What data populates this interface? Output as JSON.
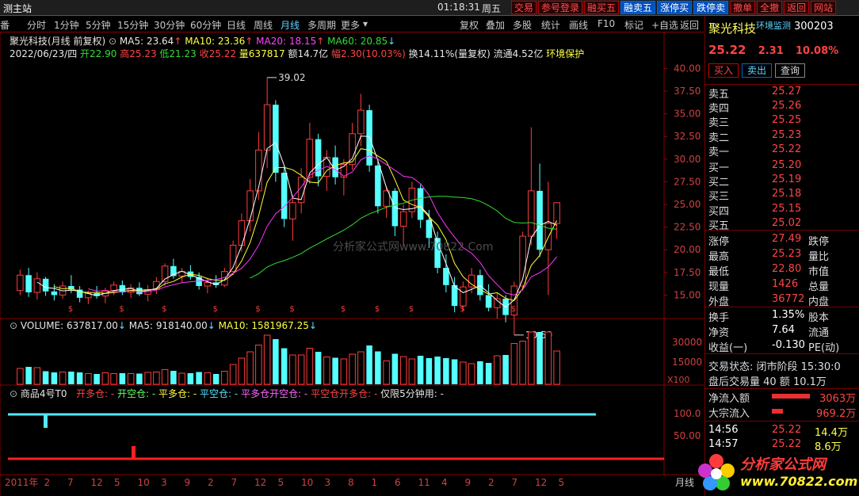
{
  "window": {
    "title": "测主站",
    "clock": "01:18:31",
    "weekday": "周五"
  },
  "top_buttons": [
    "交易",
    "参号登录",
    "融买五",
    "融卖五",
    "涨停买",
    "跌停卖",
    "撤单",
    "全撤",
    "返回",
    "网站"
  ],
  "nav": {
    "items": [
      "分时",
      "1分钟",
      "5分钟",
      "15分钟",
      "30分钟",
      "60分钟",
      "日线",
      "周线",
      "月线",
      "多周期",
      "更多"
    ],
    "right_items": [
      "复权",
      "叠加",
      "多股",
      "统计",
      "画线",
      "F10",
      "标记",
      "+自选",
      "返回"
    ],
    "active": "月线"
  },
  "stock": {
    "title": "聚光科技(月线 前复权)",
    "ma5": "MA5: 23.64",
    "ma10": "MA10: 23.36",
    "ma20": "MA20: 18.15",
    "ma60": "MA60: 20.85",
    "date": "2022/06/23/四",
    "open": "开22.90",
    "high": "高25.23",
    "low": "低21.23",
    "close": "收25.22",
    "vol": "量637817",
    "amt": "额14.7亿",
    "range": "幅2.30(10.03%)",
    "turnover": "换14.11%(量复权)",
    "float": "流通4.52亿",
    "env": "环境保护"
  },
  "volume": {
    "label": "VOLUME: 637817.00",
    "ma5": "MA5: 918140.00",
    "ma10": "MA10: 1581967.25"
  },
  "indicator": {
    "name": "商品4号T0",
    "kd": "开多仓: -",
    "kk": "开空仓: -",
    "pd": "平多仓: -",
    "pk": "平空仓: -",
    "pdkk": "平多仓开空仓: -",
    "pkkd": "平空仓开多仓: -",
    "only": "仅限5分钟用: -"
  },
  "watermark": "分析家公式网www.70822.Com",
  "annotations": {
    "high": "39.02",
    "low": "10.59"
  },
  "right_panel": {
    "name": "聚光科技",
    "monitor": "环境监测",
    "code": "300203",
    "price": "25.22",
    "change": "2.31",
    "pct": "10.08%",
    "buy": "买入",
    "sell": "卖出",
    "query": "查询",
    "asks": [
      {
        "l": "卖五",
        "v": "25.27"
      },
      {
        "l": "卖四",
        "v": "25.26"
      },
      {
        "l": "卖三",
        "v": "25.25"
      },
      {
        "l": "卖二",
        "v": "25.23"
      },
      {
        "l": "卖一",
        "v": "25.22"
      }
    ],
    "bids": [
      {
        "l": "买一",
        "v": "25.20"
      },
      {
        "l": "买二",
        "v": "25.19"
      },
      {
        "l": "买三",
        "v": "25.18"
      },
      {
        "l": "买四",
        "v": "25.15"
      },
      {
        "l": "买五",
        "v": "25.02"
      }
    ],
    "stats": [
      {
        "l": "涨停",
        "v": "27.49",
        "r": "跌停"
      },
      {
        "l": "最高",
        "v": "25.23",
        "r": "量比"
      },
      {
        "l": "最低",
        "v": "22.80",
        "r": "市值"
      },
      {
        "l": "现量",
        "v": "1426",
        "r": "总量"
      },
      {
        "l": "外盘",
        "v": "36772",
        "r": "内盘"
      }
    ],
    "stats2": [
      {
        "l": "换手",
        "v": "1.35%",
        "r": "股本"
      },
      {
        "l": "净资",
        "v": "7.64",
        "r": "流通"
      },
      {
        "l": "收益(一)",
        "v": "-0.130",
        "r": "PE(动)"
      }
    ],
    "trade_state": "交易状态: 闭市阶段 15:30:0",
    "after": "盘后交易量 40 额 10.1万",
    "net_in": "净流入额",
    "net_in_v": "3063万",
    "block_in": "大宗流入",
    "block_in_v": "969.2万",
    "ticks": [
      {
        "t": "14:56",
        "p": "25.22",
        "v": "14.4万"
      },
      {
        "t": "14:57",
        "p": "25.22",
        "v": "8.6万"
      }
    ]
  },
  "logo": {
    "text1": "分析家公式网",
    "text2": "www.70822.com"
  },
  "period_label": "月线",
  "x100": "X100",
  "chart_data": {
    "type": "candlestick",
    "y_ticks": [
      "40.00",
      "37.50",
      "35.00",
      "32.50",
      "30.00",
      "27.50",
      "25.00",
      "22.50",
      "20.00",
      "17.50",
      "15.00"
    ],
    "vol_ticks": [
      "30000",
      "15000"
    ],
    "ind_ticks": [
      "100.0",
      "50.00"
    ],
    "x_labels": [
      "2011年",
      "2",
      "7",
      "12",
      "5",
      "10",
      "3",
      "9",
      "2",
      "7",
      "12",
      "5",
      "10",
      "3",
      "8",
      "1",
      "6",
      "11",
      "4",
      "9",
      "2",
      "7",
      "12",
      "5"
    ],
    "ylim": [
      12.5,
      41
    ],
    "candles": [
      [
        15.5,
        17.8,
        15.0,
        17.2
      ],
      [
        17.2,
        18.0,
        14.8,
        15.3
      ],
      [
        15.3,
        17.5,
        14.5,
        16.8
      ],
      [
        16.8,
        17.0,
        14.9,
        15.4
      ],
      [
        15.4,
        16.2,
        14.4,
        15.0
      ],
      [
        15.0,
        16.5,
        14.6,
        16.0
      ],
      [
        16.0,
        17.2,
        15.2,
        15.6
      ],
      [
        15.6,
        16.0,
        14.2,
        14.7
      ],
      [
        14.7,
        15.5,
        14.0,
        15.2
      ],
      [
        15.2,
        16.0,
        14.6,
        14.9
      ],
      [
        14.9,
        15.8,
        14.1,
        15.5
      ],
      [
        15.5,
        16.5,
        15.0,
        16.1
      ],
      [
        16.1,
        16.6,
        15.0,
        15.3
      ],
      [
        15.3,
        16.2,
        14.7,
        15.8
      ],
      [
        15.8,
        16.4,
        14.9,
        15.1
      ],
      [
        15.1,
        16.1,
        14.3,
        15.6
      ],
      [
        15.6,
        17.0,
        15.1,
        16.5
      ],
      [
        16.5,
        18.5,
        16.0,
        18.2
      ],
      [
        18.2,
        19.0,
        16.8,
        17.1
      ],
      [
        17.1,
        18.0,
        16.4,
        17.6
      ],
      [
        17.6,
        18.3,
        16.7,
        17.0
      ],
      [
        17.0,
        17.5,
        15.6,
        16.0
      ],
      [
        16.0,
        16.9,
        15.2,
        16.4
      ],
      [
        16.4,
        17.2,
        15.8,
        16.1
      ],
      [
        16.1,
        18.0,
        15.9,
        17.6
      ],
      [
        17.6,
        21.0,
        17.2,
        20.5
      ],
      [
        20.5,
        24.0,
        19.8,
        23.2
      ],
      [
        23.2,
        27.8,
        22.0,
        26.5
      ],
      [
        26.5,
        33.0,
        25.5,
        31.0
      ],
      [
        31.0,
        39.0,
        29.0,
        36.0
      ],
      [
        36.0,
        36.5,
        27.5,
        28.5
      ],
      [
        28.5,
        29.2,
        22.5,
        23.4
      ],
      [
        23.4,
        26.0,
        21.0,
        25.2
      ],
      [
        25.2,
        29.0,
        24.0,
        28.0
      ],
      [
        28.0,
        34.0,
        27.3,
        32.2
      ],
      [
        32.2,
        32.8,
        27.0,
        28.1
      ],
      [
        28.1,
        31.0,
        26.5,
        30.2
      ],
      [
        30.2,
        31.5,
        27.2,
        28.0
      ],
      [
        28.0,
        30.0,
        26.0,
        29.4
      ],
      [
        29.4,
        34.0,
        28.8,
        32.8
      ],
      [
        32.8,
        37.2,
        31.4,
        35.4
      ],
      [
        35.4,
        36.0,
        28.6,
        29.3
      ],
      [
        29.3,
        29.9,
        24.0,
        24.8
      ],
      [
        24.8,
        27.0,
        23.5,
        26.5
      ],
      [
        26.5,
        26.8,
        21.5,
        22.6
      ],
      [
        22.6,
        25.0,
        20.4,
        24.2
      ],
      [
        24.2,
        27.5,
        23.5,
        26.8
      ],
      [
        26.8,
        27.2,
        22.4,
        23.3
      ],
      [
        23.3,
        24.4,
        20.2,
        21.3
      ],
      [
        21.3,
        22.0,
        17.4,
        18.0
      ],
      [
        18.0,
        19.5,
        15.3,
        16.1
      ],
      [
        16.1,
        17.0,
        13.1,
        13.8
      ],
      [
        13.8,
        16.5,
        13.3,
        15.9
      ],
      [
        15.9,
        18.0,
        15.2,
        17.2
      ],
      [
        17.2,
        17.8,
        14.4,
        15.0
      ],
      [
        15.0,
        16.2,
        13.2,
        13.6
      ],
      [
        13.6,
        15.2,
        12.4,
        14.6
      ],
      [
        14.6,
        15.0,
        12.0,
        12.8
      ],
      [
        12.8,
        16.5,
        10.6,
        16.0
      ],
      [
        16.0,
        22.0,
        15.5,
        21.5
      ],
      [
        21.5,
        33.5,
        20.5,
        26.5
      ],
      [
        26.5,
        29.5,
        19.2,
        20.0
      ],
      [
        20.0,
        27.5,
        15.0,
        22.9
      ],
      [
        22.9,
        25.2,
        21.2,
        25.2
      ]
    ]
  }
}
